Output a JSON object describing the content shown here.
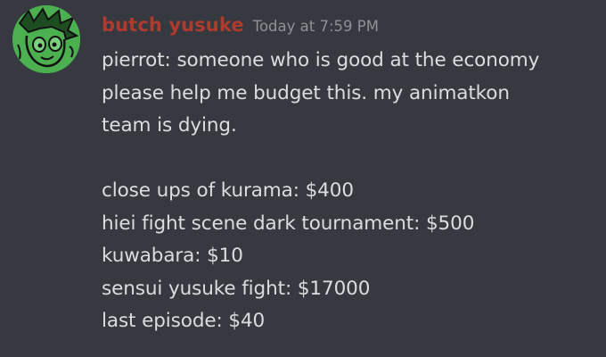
{
  "message": {
    "author": {
      "username": "butch yusuke",
      "avatar_icon": "cartoon-face-avatar",
      "name_color": "#b03a2e"
    },
    "timestamp": "Today at 7:59 PM",
    "body_lines": [
      "pierrot: someone who is good at the economy",
      "please help me budget this. my animatkon",
      "team is dying."
    ],
    "budget_lines": [
      "close ups of kurama: $400",
      "hiei fight scene dark tournament: $500",
      "kuwabara: $10",
      "sensui yusuke fight: $17000",
      "last episode: $40"
    ]
  }
}
